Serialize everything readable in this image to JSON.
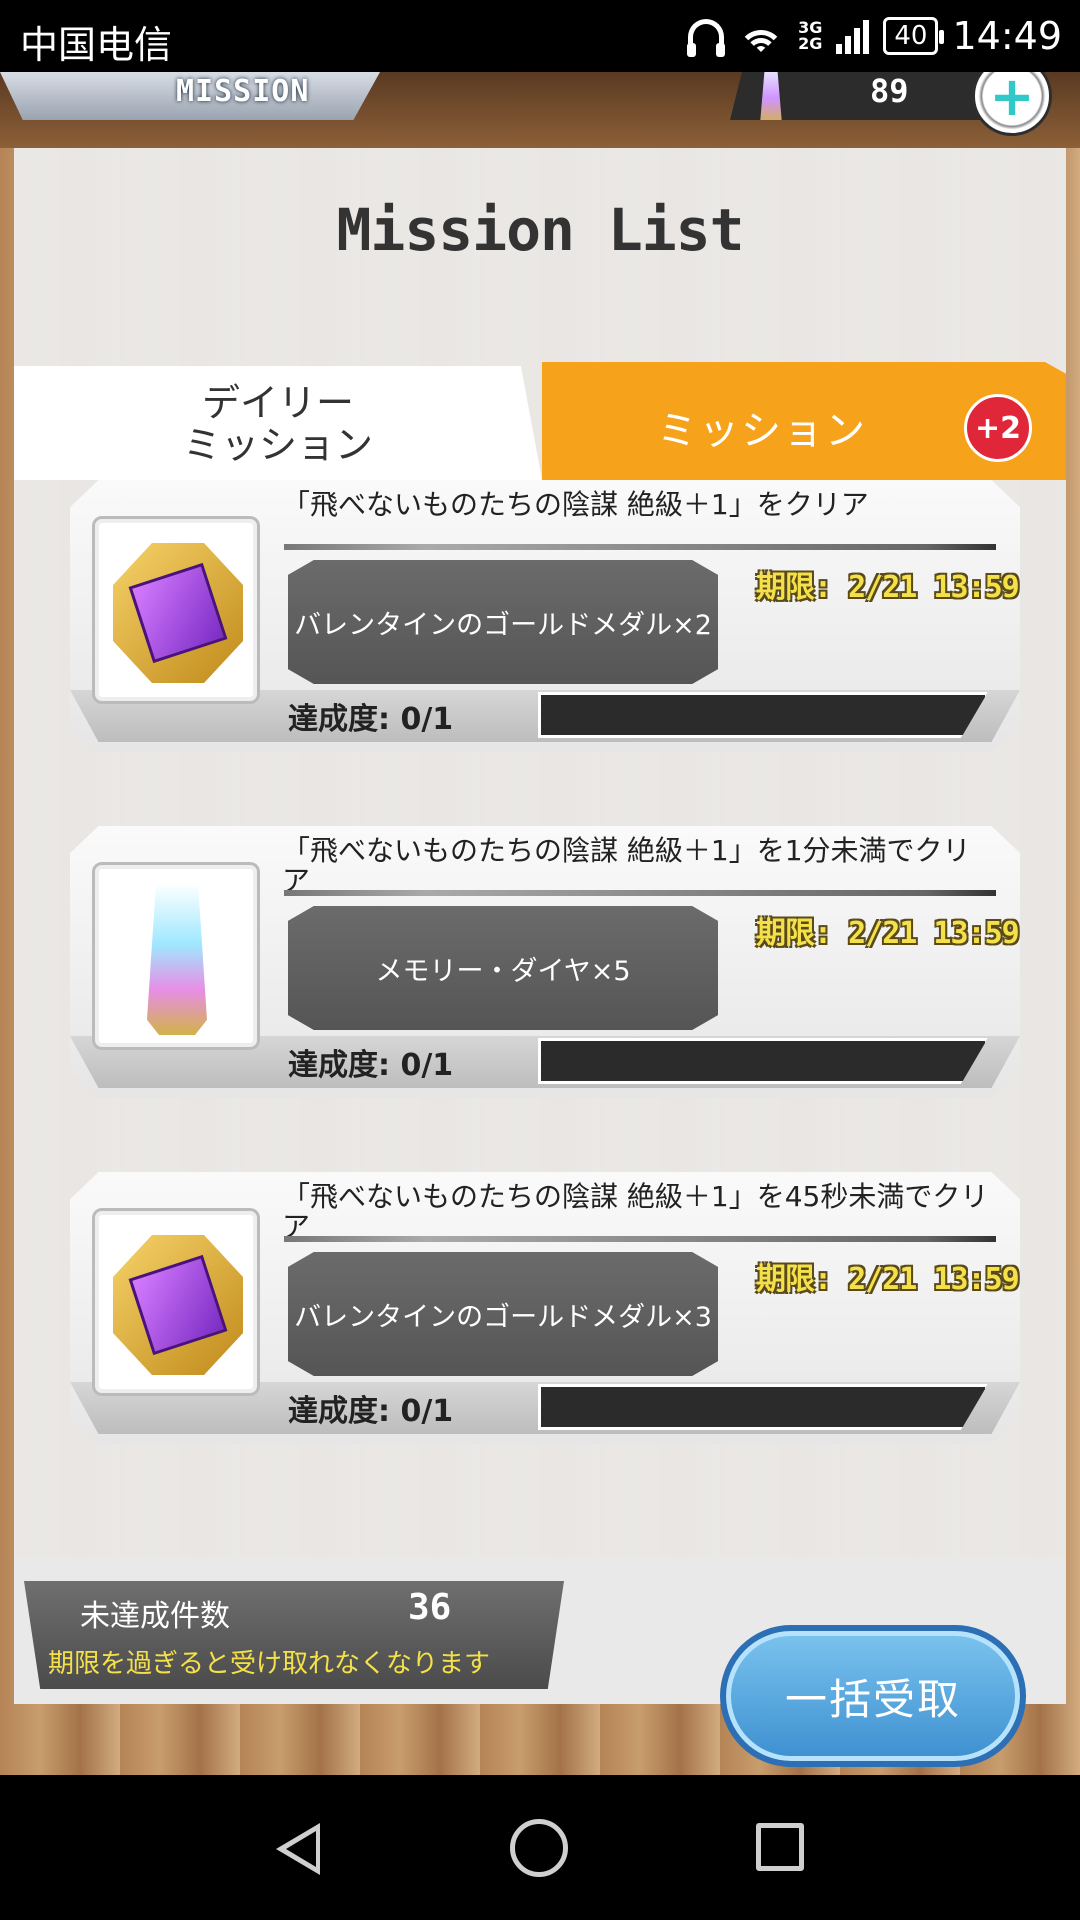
{
  "status_bar": {
    "carrier": "中国电信",
    "network": [
      "3G",
      "2G"
    ],
    "battery": "40",
    "time": "14:49"
  },
  "top_bar": {
    "mission_label": "MISSION",
    "currency_amount": "89",
    "plus_label": "+"
  },
  "panel": {
    "title": "Mission List",
    "tabs": {
      "daily": "デイリー\nミッション",
      "mission": "ミッション",
      "badge": "+2"
    }
  },
  "missions": [
    {
      "text": "「飛べないものたちの陰謀 絶級＋1」をクリア",
      "reward": "バレンタインのゴールドメダル×2",
      "deadline": "期限: 2/21 13:59",
      "progress": "達成度: 0/1",
      "icon": "chocolate-medal-icon"
    },
    {
      "text": "「飛べないものたちの陰謀 絶級＋1」を1分未満でクリア",
      "reward": "メモリー・ダイヤ×5",
      "deadline": "期限: 2/21 13:59",
      "progress": "達成度: 0/1",
      "icon": "memory-diamond-icon"
    },
    {
      "text": "「飛べないものたちの陰謀 絶級＋1」を45秒未満でクリア",
      "reward": "バレンタインのゴールドメダル×3",
      "deadline": "期限: 2/21 13:59",
      "progress": "達成度: 0/1",
      "icon": "chocolate-medal-icon"
    }
  ],
  "footer": {
    "uncompleted_label": "未達成件数",
    "uncompleted_count": "36",
    "warning": "期限を過ぎると受け取れなくなります",
    "bulk_receive": "一括受取"
  }
}
